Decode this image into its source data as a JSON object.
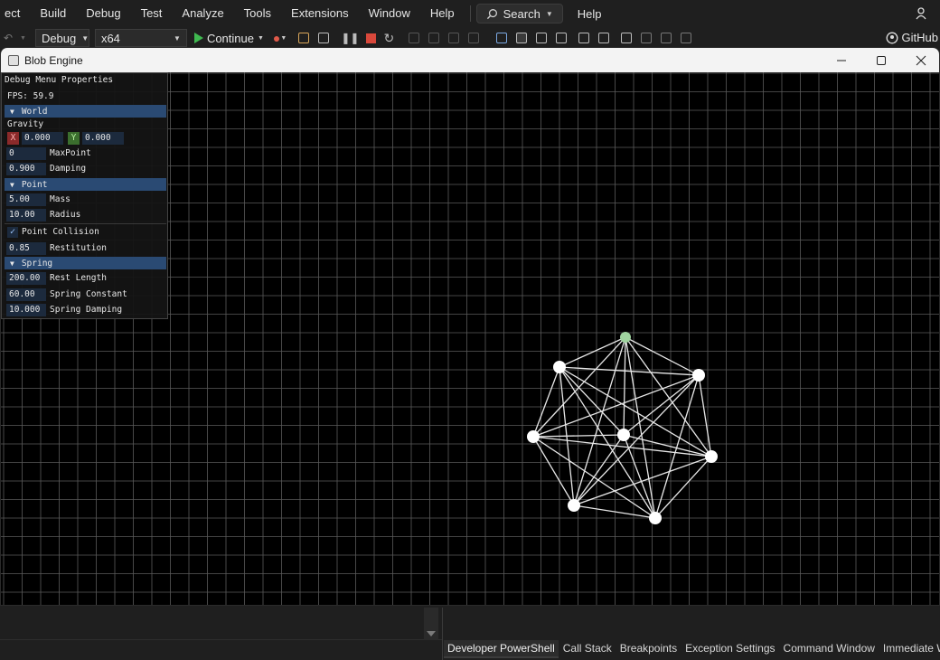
{
  "ide": {
    "menu": [
      "ect",
      "Build",
      "Debug",
      "Test",
      "Analyze",
      "Tools",
      "Extensions",
      "Window",
      "Help"
    ],
    "search_label": "Search",
    "help_label": "Help",
    "toolbar": {
      "config": "Debug",
      "platform": "x64",
      "continue_label": "Continue"
    },
    "github_label": "GitHub"
  },
  "window": {
    "title": "Blob Engine"
  },
  "debug_panel": {
    "title": "Debug Menu Properties",
    "fps": "FPS: 59.9",
    "world": {
      "header": "World",
      "gravity_label": "Gravity",
      "gravity_x_axis": "X",
      "gravity_x": "0.000",
      "gravity_y_axis": "Y",
      "gravity_y": "0.000",
      "max_point": "0",
      "max_point_label": "MaxPoint",
      "damping": "0.900",
      "damping_label": "Damping"
    },
    "point": {
      "header": "Point",
      "mass": "5.00",
      "mass_label": "Mass",
      "radius": "10.00",
      "radius_label": "Radius",
      "collision_label": "Point Collision",
      "collision_checked": true,
      "restitution": "0.85",
      "restitution_label": "Restitution"
    },
    "spring": {
      "header": "Spring",
      "rest_length": "200.00",
      "rest_length_label": "Rest Length",
      "constant": "60.00",
      "constant_label": "Spring Constant",
      "damping": "10.000",
      "damping_label": "Spring Damping"
    }
  },
  "bottom_tabs": [
    "Developer PowerShell",
    "Call Stack",
    "Breakpoints",
    "Exception Settings",
    "Command Window",
    "Immediate Window"
  ],
  "colors": {
    "grid": "#5a5a5a",
    "node": "#ffffff",
    "selected_node": "#9fd49f",
    "header": "#2a4a73"
  }
}
